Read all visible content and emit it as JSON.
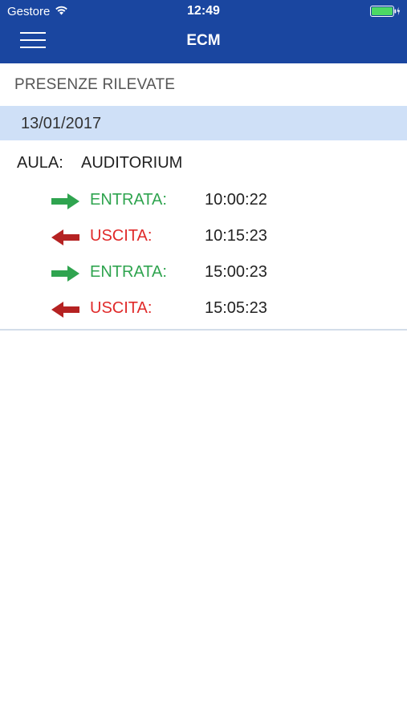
{
  "status_bar": {
    "carrier": "Gestore",
    "time": "12:49",
    "battery_level": 1.0
  },
  "nav": {
    "title": "ECM"
  },
  "section": {
    "title": "PRESENZE RILEVATE"
  },
  "record": {
    "date": "13/01/2017",
    "aula_label": "AULA:",
    "aula_value": "AUDITORIUM",
    "events": [
      {
        "type": "ENTRATA:",
        "time": "10:00:22",
        "direction": "in",
        "icon": "arrow-right-icon"
      },
      {
        "type": "USCITA:",
        "time": "10:15:23",
        "direction": "out",
        "icon": "arrow-left-icon"
      },
      {
        "type": "ENTRATA:",
        "time": "15:00:23",
        "direction": "in",
        "icon": "arrow-right-icon"
      },
      {
        "type": "USCITA:",
        "time": "15:05:23",
        "direction": "out",
        "icon": "arrow-left-icon"
      }
    ]
  },
  "colors": {
    "header_blue": "#1a46a0",
    "date_band": "#cfe0f7",
    "entry_green": "#2fa44f",
    "exit_red": "#e02a2a",
    "arrow_dark_red": "#b52222"
  }
}
